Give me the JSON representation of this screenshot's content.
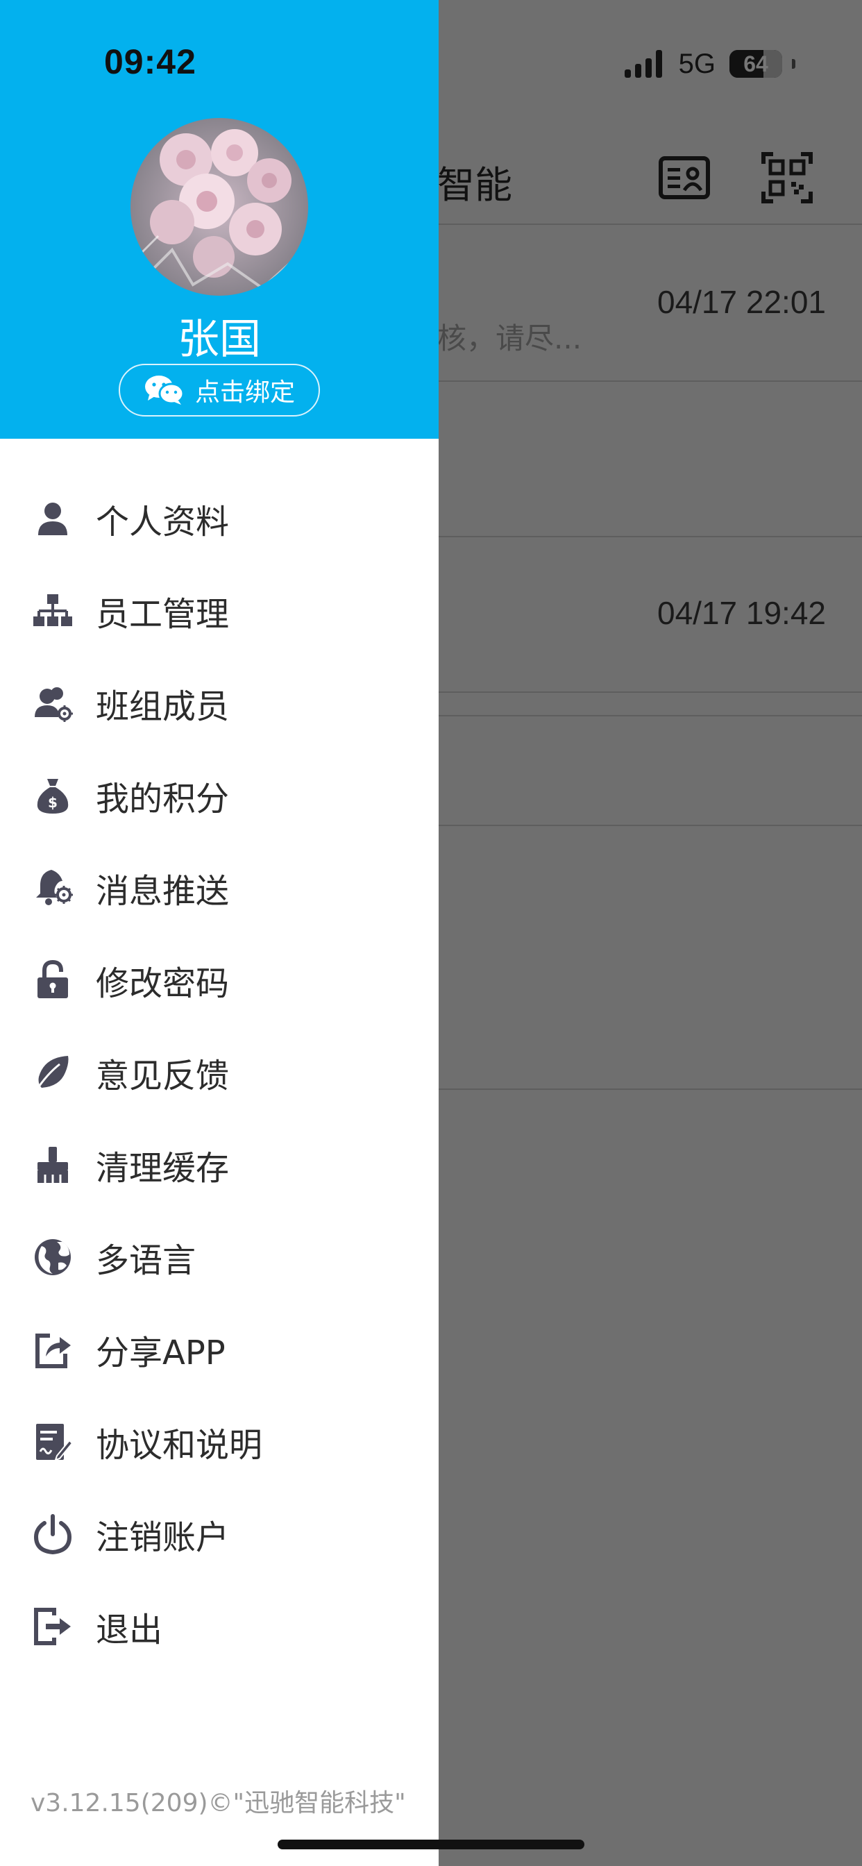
{
  "status_bar": {
    "time": "09:42",
    "network": "5G",
    "battery": "64",
    "battery_level": 0.64
  },
  "background": {
    "title_fragment": "智能",
    "rows": [
      {
        "time": "04/17 22:01",
        "snippet": "核，请尽..."
      },
      {
        "time": "04/17 19:42",
        "snippet": ""
      }
    ],
    "icons": [
      "id-card-icon",
      "qr-code-icon"
    ]
  },
  "drawer": {
    "user_name": "张国",
    "bind_label": "点击绑定",
    "menu": [
      {
        "label": "个人资料",
        "icon": "user-icon"
      },
      {
        "label": "员工管理",
        "icon": "org-chart-icon"
      },
      {
        "label": "班组成员",
        "icon": "users-gear-icon"
      },
      {
        "label": "我的积分",
        "icon": "money-bag-icon"
      },
      {
        "label": "消息推送",
        "icon": "bell-gear-icon"
      },
      {
        "label": "修改密码",
        "icon": "lock-open-icon"
      },
      {
        "label": "意见反馈",
        "icon": "leaf-icon"
      },
      {
        "label": "清理缓存",
        "icon": "broom-icon"
      },
      {
        "label": "多语言",
        "icon": "globe-icon"
      },
      {
        "label": "分享APP",
        "icon": "share-icon"
      },
      {
        "label": "协议和说明",
        "icon": "document-edit-icon"
      },
      {
        "label": "注销账户",
        "icon": "power-icon"
      },
      {
        "label": "退出",
        "icon": "logout-icon"
      }
    ],
    "version": "v3.12.15(209)©\"迅驰智能科技\""
  },
  "colors": {
    "header": "#03b1ee",
    "icon": "#4a4a5a",
    "overlay": "#6f6f6f"
  }
}
